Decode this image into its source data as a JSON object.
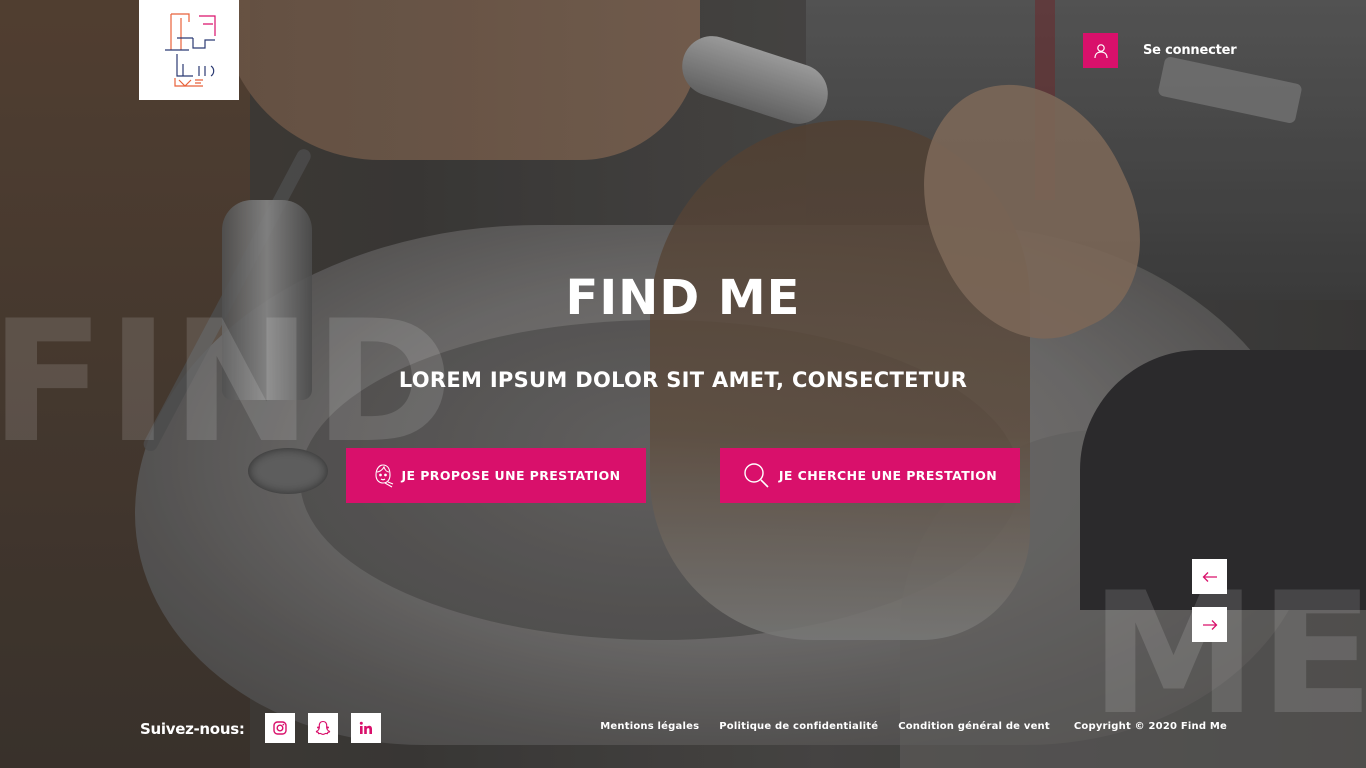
{
  "brand": {
    "logo_name": "Find Me logo",
    "accent": "#d9106b"
  },
  "header": {
    "user_icon": "user-icon",
    "login_label": "Se connecter"
  },
  "hero": {
    "ghost_left": "FIND",
    "ghost_right": "ME",
    "title": "FIND ME",
    "subtitle": "LOREM IPSUM DOLOR SIT AMET, CONSECTETUR",
    "buttons": [
      {
        "label": "JE PROPOSE UNE PRESTATION",
        "icon": "hairdresser-face-icon"
      },
      {
        "label": "JE CHERCHE UNE PRESTATION",
        "icon": "search-icon"
      }
    ]
  },
  "slider": {
    "prev_icon": "arrow-left-icon",
    "next_icon": "arrow-right-icon"
  },
  "footer": {
    "follow_label": "Suivez-nous:",
    "social": [
      "instagram-icon",
      "snapchat-icon",
      "linkedin-icon"
    ],
    "links": [
      "Mentions légales",
      "Politique de confidentialité",
      "Condition général de vent"
    ],
    "copyright": "Copyright © 2020 Find Me"
  }
}
